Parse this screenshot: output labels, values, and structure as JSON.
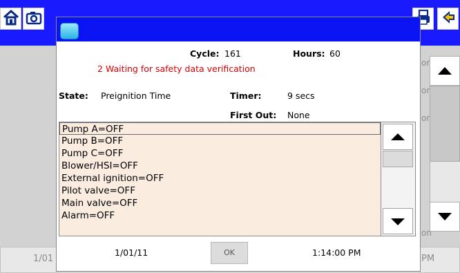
{
  "background_app": {
    "side_labels": [
      "on",
      "on",
      "on",
      "on"
    ],
    "footer_left": "1/01",
    "footer_right": "PM"
  },
  "dialog": {
    "cycle_label": "Cycle:",
    "cycle_value": "161",
    "hours_label": "Hours:",
    "hours_value": "60",
    "error_message": "2 Waiting for safety data verification",
    "state_label": "State:",
    "state_value": "Preignition Time",
    "timer_label": "Timer:",
    "timer_value": "9 secs",
    "first_out_label": "First Out:",
    "first_out_value": "None",
    "status_list": [
      "Pump A=OFF",
      "Pump B=OFF",
      "Pump C=OFF",
      "Blower/HSI=OFF",
      "External ignition=OFF",
      "Pilot valve=OFF",
      "Main valve=OFF",
      "Alarm=OFF"
    ],
    "footer": {
      "date": "1/01/11",
      "ok_label": "OK",
      "time": "1:14:00 PM"
    }
  },
  "colors": {
    "titlebar": "#0a14f2",
    "error_text": "#d40000",
    "list_background": "#fbece0"
  },
  "icons": [
    "home-icon",
    "camera-icon",
    "print-icon",
    "back-arrow-icon",
    "app-icon",
    "arrow-up-icon",
    "arrow-down-icon"
  ]
}
